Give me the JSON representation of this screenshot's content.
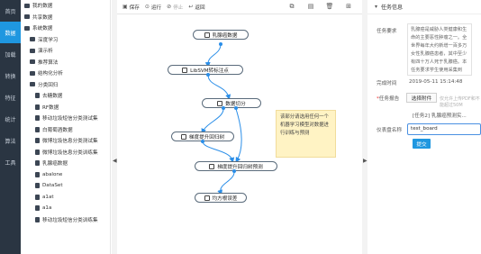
{
  "nav": {
    "items": [
      {
        "label": "首页",
        "active": false
      },
      {
        "label": "数据",
        "active": true
      },
      {
        "label": "加载",
        "active": false
      },
      {
        "label": "转换",
        "active": false
      },
      {
        "label": "特征",
        "active": false
      },
      {
        "label": "统计",
        "active": false
      },
      {
        "label": "算法",
        "active": false
      },
      {
        "label": "工具",
        "active": false
      }
    ]
  },
  "tree": {
    "items": [
      {
        "label": "我的数据",
        "kind": "folder",
        "level": 0
      },
      {
        "label": "共享数据",
        "kind": "folder",
        "level": 0
      },
      {
        "label": "系统数据",
        "kind": "folder",
        "level": 0
      },
      {
        "label": "深度学习",
        "kind": "folder",
        "level": 1
      },
      {
        "label": "演示析",
        "kind": "folder",
        "level": 1
      },
      {
        "label": "推荐算法",
        "kind": "folder",
        "level": 1
      },
      {
        "label": "结构化分析",
        "kind": "folder",
        "level": 1
      },
      {
        "label": "分类回归",
        "kind": "folder",
        "level": 1
      },
      {
        "label": "去糖数据",
        "kind": "file",
        "level": 2
      },
      {
        "label": "RF数据",
        "kind": "file",
        "level": 2
      },
      {
        "label": "移动垃圾短信分类测试集",
        "kind": "file",
        "level": 2
      },
      {
        "label": "白葡萄酒数据",
        "kind": "file",
        "level": 2
      },
      {
        "label": "微博垃圾信息分类测试集",
        "kind": "file",
        "level": 2
      },
      {
        "label": "微博垃圾信息分类训练集",
        "kind": "file",
        "level": 2
      },
      {
        "label": "乳腺癌数据",
        "kind": "file",
        "level": 2
      },
      {
        "label": "abalone",
        "kind": "file",
        "level": 2
      },
      {
        "label": "DataSet",
        "kind": "file",
        "level": 2
      },
      {
        "label": "a1at",
        "kind": "file",
        "level": 2
      },
      {
        "label": "a1a",
        "kind": "file",
        "level": 2
      },
      {
        "label": "移动垃圾短信分类训练集",
        "kind": "file",
        "level": 2
      }
    ]
  },
  "toolbar": {
    "save": "保存",
    "run": "运行",
    "stop": "停止",
    "back": "返回",
    "save_icon": "save-icon",
    "run_icon": "play-icon",
    "stop_icon": "stop-icon",
    "back_icon": "back-icon"
  },
  "workflow": {
    "nodes": [
      {
        "id": "n1",
        "label": "乳腺癌数据"
      },
      {
        "id": "n2",
        "label": "LibSVM转标注点"
      },
      {
        "id": "n3",
        "label": "数据切分"
      },
      {
        "id": "n4",
        "label": "梯度提升回归树"
      },
      {
        "id": "n5",
        "label": "梯度提升回归树预测"
      },
      {
        "id": "n6",
        "label": "均方根误差"
      }
    ],
    "hint": "该部分请选用任何一个机器学习模型对数据进行训练与预测"
  },
  "panel": {
    "title": "任务信息",
    "requirement_label": "任务要求",
    "requirement_text": "乳腺癌是威胁人类健康和生命的主要恶性肿瘤之一。全世界每年大约新增一百多万女性乳腺癌患者，其中至少有四十万人死于乳腺癌。本任务要求学生使用采集到",
    "completion_label": "完成时间",
    "completion_time": "2019-05-11 15:14:48",
    "report_label": "任务报告",
    "choose_file_label": "选择附件",
    "report_placeholder": "仅允许上传PDF和不能超过50M",
    "task_name_label": "任务名称",
    "task_name_hint": "[任务2] 乳腺癌预测实...",
    "repo_name_label": "仪表盘名称",
    "repo_name_value": "test_board",
    "submit_label": "提交"
  },
  "colors": {
    "nav_bg": "#2a3542",
    "accent": "#1f97e0",
    "edge": "#2a8ee8",
    "hint_bg": "#fff3c4"
  }
}
